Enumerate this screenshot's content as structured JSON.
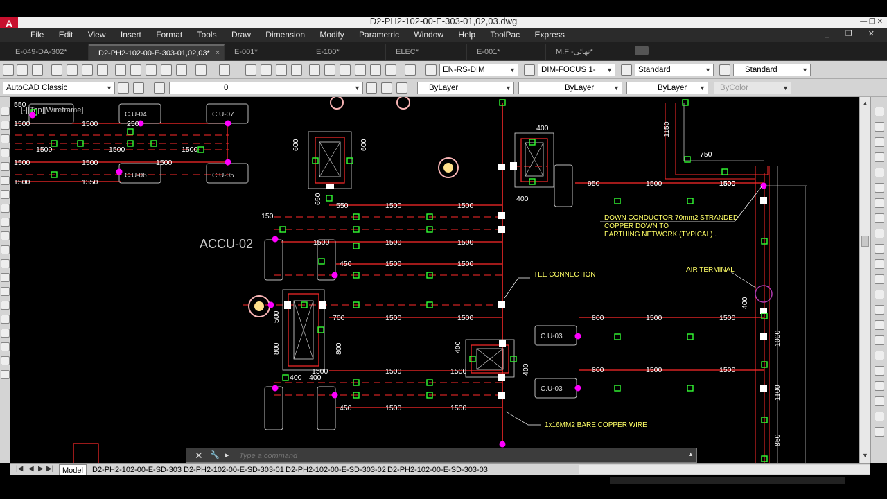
{
  "app": {
    "logo": "A",
    "title": "D2-PH2-102-00-E-303-01,02,03.dwg",
    "window_controls": "— ❐ ✕"
  },
  "menu": [
    "File",
    "Edit",
    "View",
    "Insert",
    "Format",
    "Tools",
    "Draw",
    "Dimension",
    "Modify",
    "Parametric",
    "Window",
    "Help",
    "ToolPac",
    "Express"
  ],
  "mdi_controls": "_ ❐ ✕",
  "tabs": [
    {
      "label": "E-049-DA-302*",
      "active": false
    },
    {
      "label": "D2-PH2-102-00-E-303-01,02,03*",
      "active": true,
      "close": "×"
    },
    {
      "label": "E-001*",
      "active": false
    },
    {
      "label": "E-100*",
      "active": false
    },
    {
      "label": "ELEC*",
      "active": false
    },
    {
      "label": "E-001*",
      "active": false
    },
    {
      "label": "M.F -نهائى*",
      "active": false
    }
  ],
  "toolbar": {
    "text_style": "EN-RS-DIM",
    "dim_style": "DIM-FOCUS 1-",
    "table_style": "Standard",
    "multileader_style": "Standard",
    "workspace": "AutoCAD Classic",
    "layer": "0",
    "color": "ByLayer",
    "linetype": "ByLayer",
    "lineweight": "ByLayer",
    "plotstyle": "ByColor"
  },
  "viewport_label": "[-][Top][Wireframe]",
  "command": {
    "placeholder": "Type a command",
    "close": "✕",
    "wrench": "🔧",
    "prompt": "▸",
    "up": "▲"
  },
  "layout_tabs": [
    {
      "label": "Model",
      "active": true
    },
    {
      "label": "D2-PH2-102-00-E-SD-303",
      "active": false
    },
    {
      "label": "D2-PH2-102-00-E-SD-303-01",
      "active": false
    },
    {
      "label": "D2-PH2-102-00-E-SD-303-02",
      "active": false
    },
    {
      "label": "D2-PH2-102-00-E-SD-303-03",
      "active": false
    }
  ],
  "drawing": {
    "accu_label": "ACCU-02",
    "cu_labels": [
      "C.U-04",
      "C.U-07",
      "C.U-06",
      "C.U-05",
      "C.U-03",
      "C.U-03"
    ],
    "annotations": {
      "down_conductor": [
        "DOWN CONDUCTOR 70mm2 STRANDED",
        "COPPER DOWN TO",
        "EARTHING NETWORK (TYPICAL) ."
      ],
      "air_terminal": "AIR TERMINAL",
      "tee": "TEE CONNECTION",
      "bare_wire": "1x16MM2 BARE COPPER WIRE"
    },
    "dims": [
      "550",
      "1500",
      "250",
      "1500",
      "1500",
      "1500",
      "1500",
      "1500",
      "1500",
      "1500",
      "1500",
      "1350",
      "600",
      "600",
      "650",
      "550",
      "1500",
      "1500",
      "150",
      "1500",
      "1500",
      "1500",
      "450",
      "1500",
      "1500",
      "500",
      "700",
      "1500",
      "1500",
      "800",
      "800",
      "400",
      "400",
      "1500",
      "1500",
      "1500",
      "450",
      "1500",
      "1500",
      "400",
      "400",
      "950",
      "1500",
      "1500",
      "1150",
      "750",
      "1500",
      "1500",
      "1000",
      "1100",
      "850",
      "400",
      "800",
      "1500",
      "1500",
      "800",
      "1500",
      "1500",
      "400",
      "400"
    ]
  },
  "colors": {
    "cable": "#ff2a2a",
    "clamp": "#33ff33",
    "dim": "#ffffff",
    "node": "#ff00ff",
    "text": "#ffff66"
  }
}
